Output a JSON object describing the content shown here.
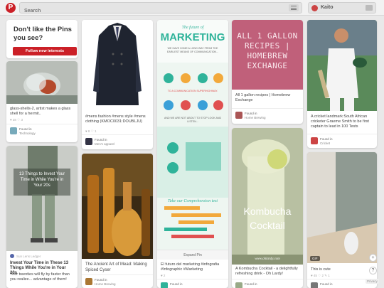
{
  "header": {
    "logo_letter": "P",
    "search_placeholder": "Search",
    "user_name": "Kaito"
  },
  "cta": {
    "title": "Don't like the Pins you see?",
    "button": "Follow new interests"
  },
  "pins": {
    "glass": {
      "desc": "glass-shells-2, artist makes a glass shell for a hermit..",
      "stats": "♥ 38   ♡ 3",
      "found": "Found in",
      "board": "Technology"
    },
    "coat": {
      "desc": "#mens fashion #mens style #mens clothing (KMOC0031:DOUBLJU)",
      "stats": "♥ 8   ♡ 1",
      "found": "Found in",
      "board": "Men's apparel"
    },
    "marketing": {
      "img_title_1": "The future of",
      "img_title_2": "MARKETING",
      "sub1": "WE HAVE COME A LONG WAY FROM THE EARLIEST MEANS OF COMMUNICATION...",
      "sub2": "TO A COMMUNICATION SUPERHIGHWAY.",
      "sub3": "AND WE ARE NOT ABOUT TO STOP LOOK AND LISTEN...",
      "sub4": "Take our Comprehension test",
      "expand": "Expand Pin",
      "desc": "El futuro del marketing #infografia #Infographic #Marketing",
      "stats": "♥ 2",
      "found": "Found in"
    },
    "gallon": {
      "img_text": "ALL 1 GALLON RECIPES | HOMEBREW EXCHANGE",
      "desc": "All 1 gallon recipes | Homebrew Exchange",
      "found": "Found in",
      "board": "Home Brewing"
    },
    "cricket": {
      "desc": "A cricket landmark:South African cricketer Graeme Smith to be first captain to lead in 100 Tests",
      "found": "Found in",
      "board": "Cricket"
    },
    "lady": {
      "img_text": "13 Things to Invest Your Time in While You're in Your 20s",
      "source": "Sun Lens Ledger",
      "title": "Invest Your Time in These 13 Things While You're in Your 20s",
      "desc": "Your twenties will fly by faster than you realize... advantage of them!"
    },
    "mead": {
      "desc": "The Ancient Art of Mead: Making Spiced Cyser",
      "found": "Found in",
      "board": "Home Brewing"
    },
    "kombucha": {
      "img_text_1": "Kombucha",
      "img_text_2": "Cocktail",
      "watermark": "www.ohlardy.com",
      "desc": "A Kombucha Cocktail - a delightfully refreshing drink - Oh Lardy!",
      "found": "Found in"
    },
    "cute": {
      "gif": "GIF",
      "desc": "This is cute",
      "stats": "♥ 45   ♡ 2   ✎ 1",
      "found": "Found in"
    }
  },
  "side": {
    "help": "?",
    "plus": "+",
    "privacy": "Privacy"
  },
  "colors": {
    "brand": "#cb2027"
  }
}
